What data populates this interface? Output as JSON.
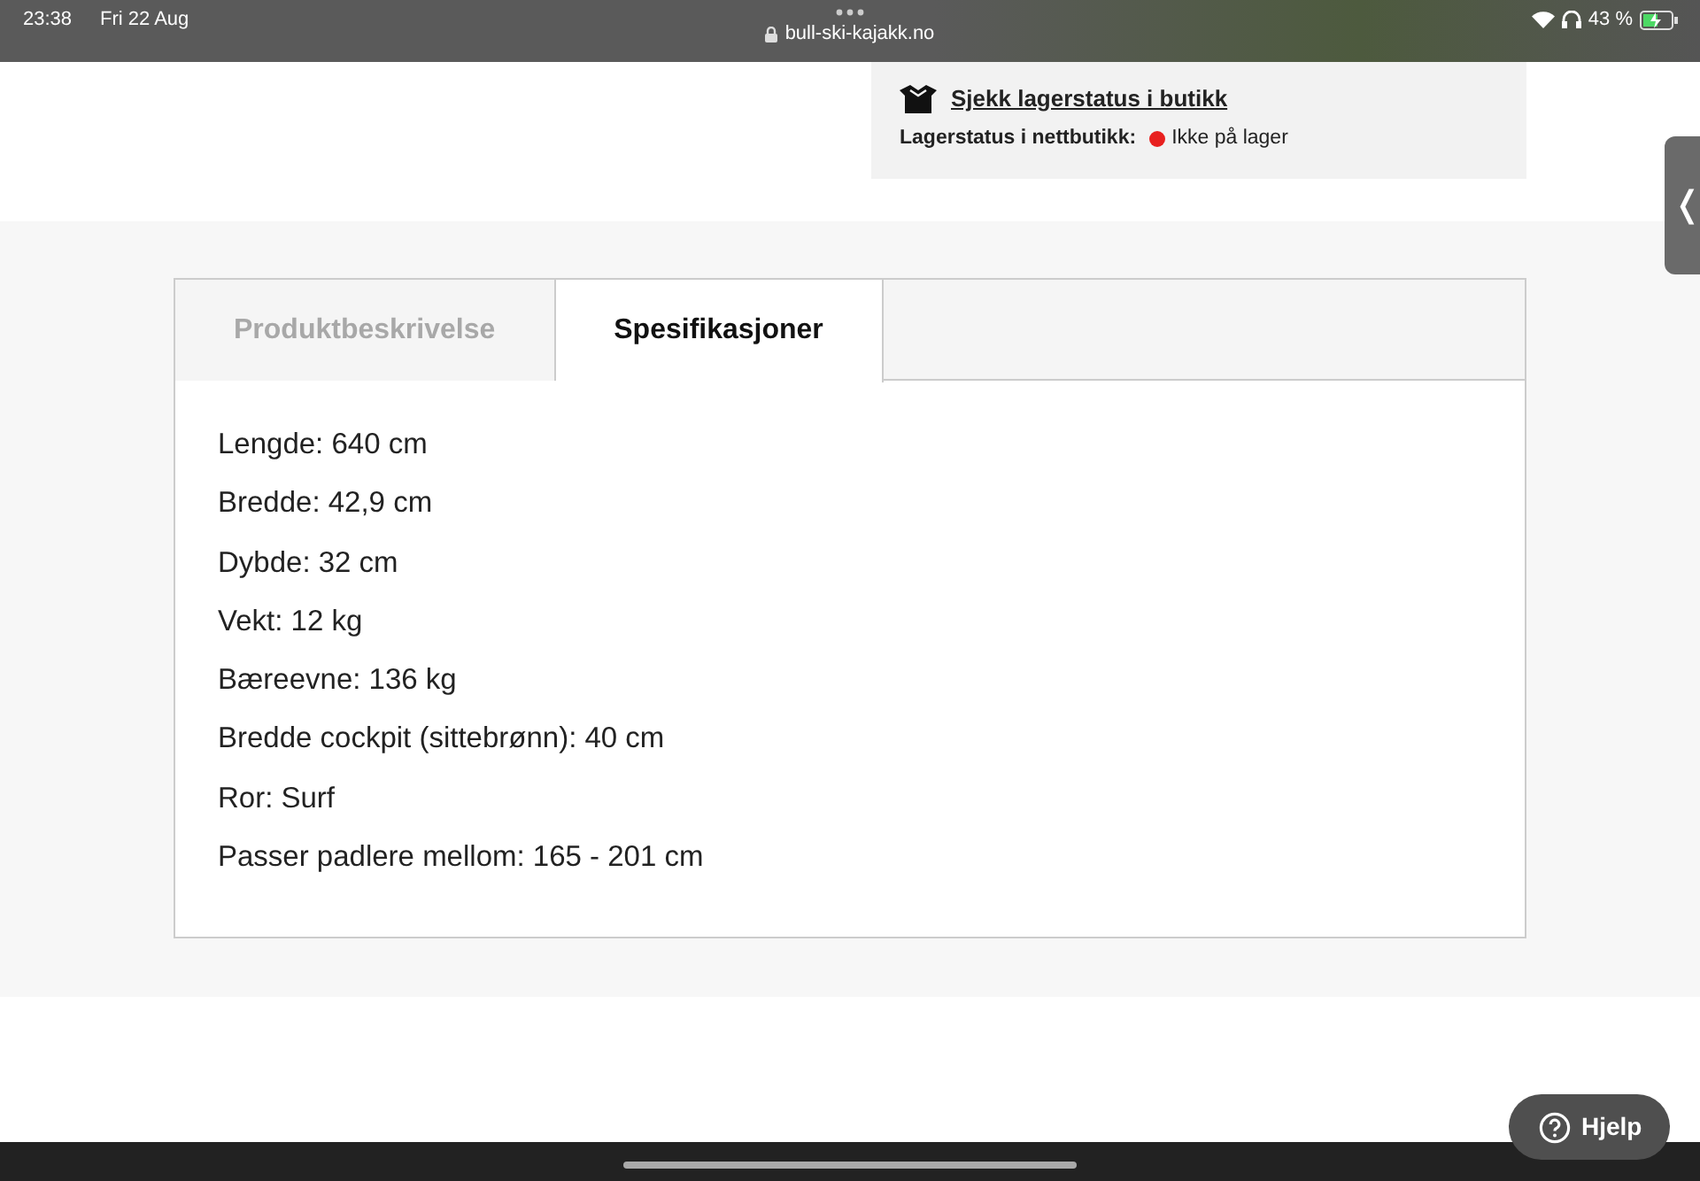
{
  "status_bar": {
    "time": "23:38",
    "date": "Fri 22 Aug",
    "url": "bull-ski-kajakk.no",
    "battery": "43 %"
  },
  "stock": {
    "store_link": "Sjekk lagerstatus i butikk",
    "online_label": "Lagerstatus i nettbutikk:",
    "online_status": "Ikke på lager",
    "status_dot": {
      "color": "#e8201f"
    }
  },
  "side_tab": {
    "glyph": "❬"
  },
  "tabs": [
    {
      "label": "Produktbeskrivelse",
      "selected": false
    },
    {
      "label": "Spesifikasjoner",
      "selected": true
    }
  ],
  "specs": [
    "Lengde: 640 cm",
    "Bredde: 42,9 cm",
    "Dybde: 32 cm",
    "Vekt: 12 kg",
    "Bæreevne: 136 kg",
    "Bredde cockpit (sittebrønn): 40 cm",
    "Ror: Surf",
    "Passer padlere mellom: 165 - 201 cm"
  ],
  "help_button": {
    "label": "Hjelp"
  }
}
